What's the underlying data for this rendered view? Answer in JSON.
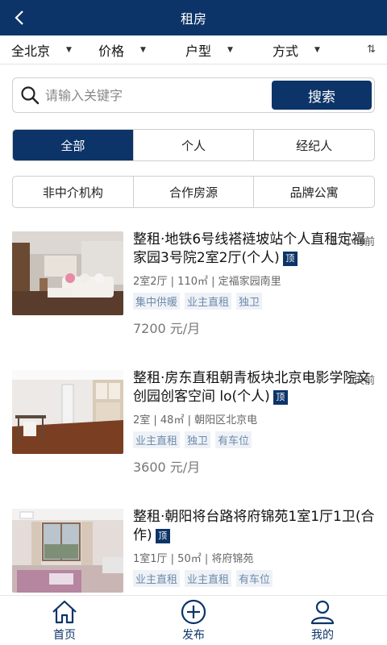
{
  "header": {
    "title": "租房"
  },
  "filters": {
    "area": "全北京",
    "price": "价格",
    "layout": "户型",
    "mode": "方式"
  },
  "search": {
    "placeholder": "请输入关键字",
    "button": "搜索"
  },
  "segment1": [
    {
      "label": "全部",
      "active": true
    },
    {
      "label": "个人",
      "active": false
    },
    {
      "label": "经纪人",
      "active": false
    }
  ],
  "segment2": [
    {
      "label": "非中介机构"
    },
    {
      "label": "合作房源"
    },
    {
      "label": "品牌公寓"
    }
  ],
  "pin_label": "顶",
  "listings": [
    {
      "title": "整租·地铁6号线褡裢坡站个人直租定福家园3号院2室2厅(个人)",
      "meta": "2室2厅 | 110㎡ | 定福家园南里",
      "tags": [
        "集中供暖",
        "业主直租",
        "独卫"
      ],
      "price": "7200 元/月",
      "time": "17小时前"
    },
    {
      "title": "整租·房东直租朝青板块北京电影学院文创园创客空间 lo(个人)",
      "meta": "2室 | 48㎡ | 朝阳区北京电",
      "tags": [
        "业主直租",
        "独卫",
        "有车位"
      ],
      "price": "3600 元/月",
      "time": "1天前"
    },
    {
      "title": "整租·朝阳将台路将府锦苑1室1厅1卫(合作)",
      "meta": "1室1厅 | 50㎡ | 将府锦苑",
      "tags": [
        "业主直租",
        "业主直租",
        "有车位"
      ],
      "price": "",
      "time": ""
    }
  ],
  "bottom_nav": [
    {
      "label": "首页",
      "icon": "home-icon"
    },
    {
      "label": "发布",
      "icon": "plus-circle-icon"
    },
    {
      "label": "我的",
      "icon": "user-icon"
    }
  ],
  "colors": {
    "primary": "#0d3468",
    "tag_bg": "#eef2f7",
    "tag_text": "#6d8aaa"
  }
}
